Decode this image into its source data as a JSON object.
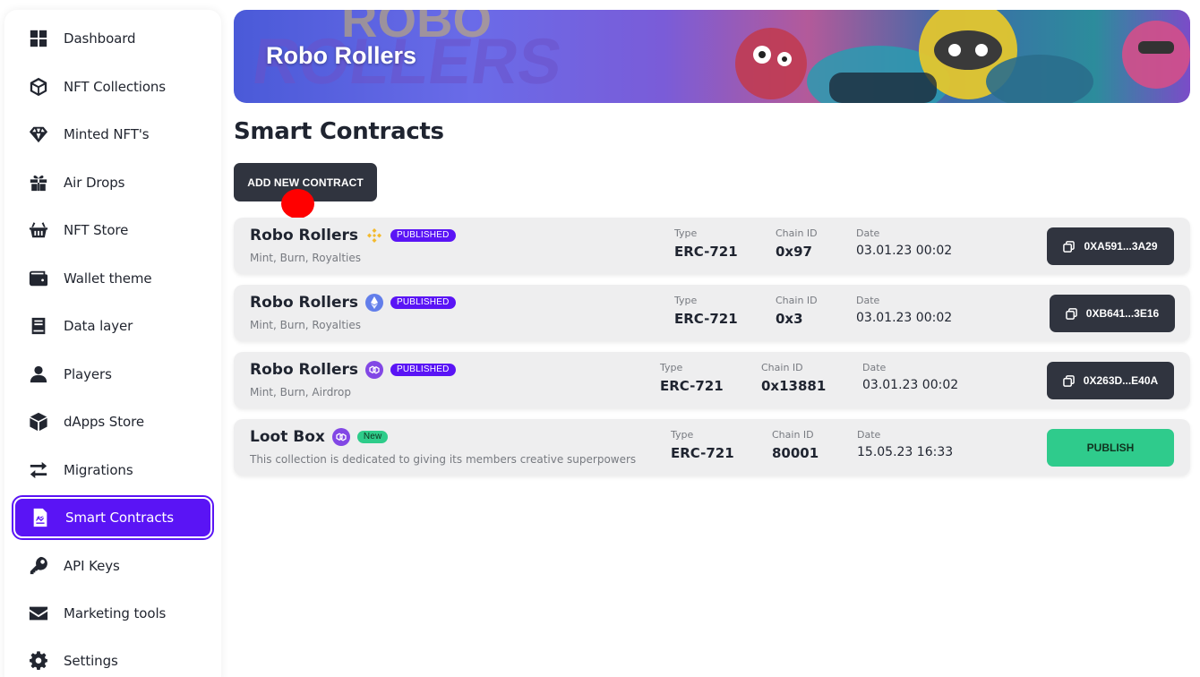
{
  "sidebar": {
    "items": [
      {
        "label": "Dashboard",
        "icon": "dashboard-icon"
      },
      {
        "label": "NFT Collections",
        "icon": "cube-icon"
      },
      {
        "label": "Minted NFT's",
        "icon": "diamond-icon"
      },
      {
        "label": "Air Drops",
        "icon": "gift-icon"
      },
      {
        "label": "NFT Store",
        "icon": "basket-icon"
      },
      {
        "label": "Wallet theme",
        "icon": "wallet-icon"
      },
      {
        "label": "Data layer",
        "icon": "book-icon"
      },
      {
        "label": "Players",
        "icon": "user-icon"
      },
      {
        "label": "dApps Store",
        "icon": "box-icon"
      },
      {
        "label": "Migrations",
        "icon": "swap-arrows-icon"
      },
      {
        "label": "Smart Contracts",
        "icon": "contract-icon",
        "active": true
      },
      {
        "label": "API Keys",
        "icon": "key-icon"
      },
      {
        "label": "Marketing tools",
        "icon": "mail-icon"
      },
      {
        "label": "Settings",
        "icon": "gear-icon"
      }
    ]
  },
  "banner": {
    "title": "Robo Rollers"
  },
  "page": {
    "title": "Smart Contracts",
    "add_button": "ADD NEW CONTRACT"
  },
  "contracts": [
    {
      "name": "Robo Rollers",
      "chain_icon": "binance-icon",
      "badge": "PUBLISHED",
      "features": "Mint, Burn, Royalties",
      "type_label": "Type",
      "type": "ERC-721",
      "chain_label": "Chain ID",
      "chain_id": "0x97",
      "date_label": "Date",
      "date": "03.01.23 00:02",
      "address": "0XA591...3A29"
    },
    {
      "name": "Robo Rollers",
      "chain_icon": "ethereum-icon",
      "badge": "PUBLISHED",
      "features": "Mint, Burn, Royalties",
      "type_label": "Type",
      "type": "ERC-721",
      "chain_label": "Chain ID",
      "chain_id": "0x3",
      "date_label": "Date",
      "date": "03.01.23 00:02",
      "address": "0XB641...3E16"
    },
    {
      "name": "Robo Rollers",
      "chain_icon": "polygon-icon",
      "badge": "PUBLISHED",
      "features": "Mint, Burn, Airdrop",
      "type_label": "Type",
      "type": "ERC-721",
      "chain_label": "Chain ID",
      "chain_id": "0x13881",
      "date_label": "Date",
      "date": "03.01.23 00:02",
      "address": "0X263D...E40A"
    },
    {
      "name": "Loot Box",
      "chain_icon": "polygon-icon",
      "badge": "New",
      "features": "This collection is dedicated to giving its members creative superpowers",
      "type_label": "Type",
      "type": "ERC-721",
      "chain_label": "Chain ID",
      "chain_id": "80001",
      "date_label": "Date",
      "date": "15.05.23 16:33",
      "action": "PUBLISH"
    }
  ],
  "colors": {
    "accent": "#5a14f5",
    "dark_button": "#30343f",
    "publish": "#2fcb8c",
    "binance": "#f3ba2f",
    "ethereum": "#627eea",
    "polygon": "#8247e5"
  }
}
